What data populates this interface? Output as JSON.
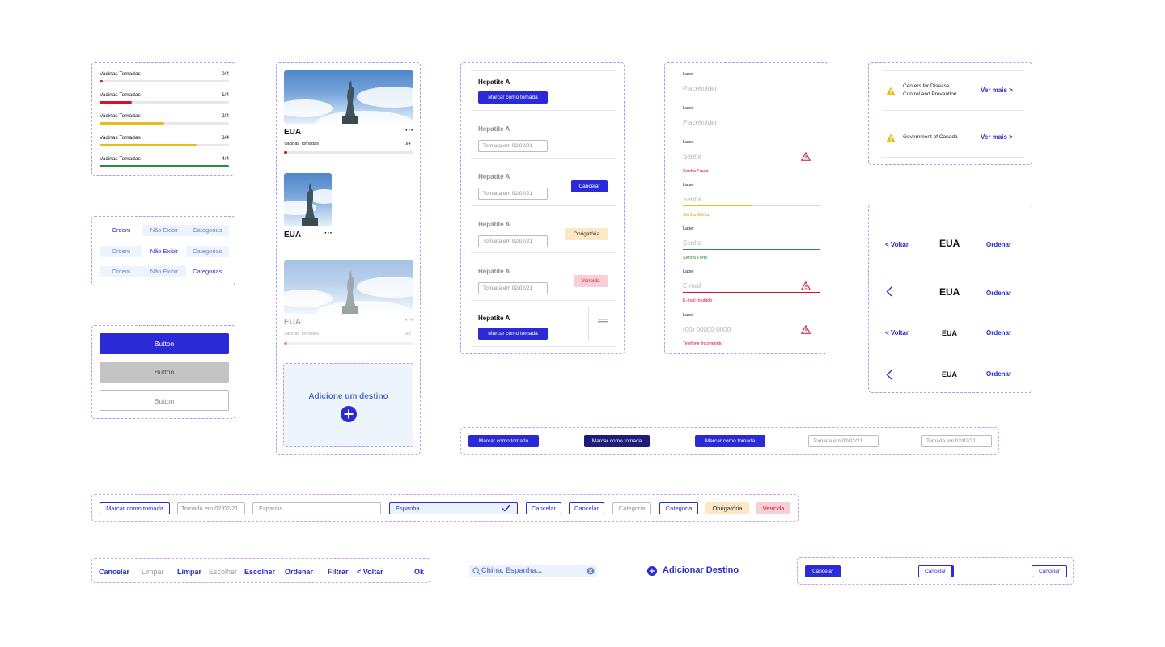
{
  "progress": {
    "rows": [
      {
        "label": "Vacinas Tomadas",
        "count": "0/4",
        "fraction": 0.0,
        "color": "#d6102c"
      },
      {
        "label": "Vacinas Tomadas",
        "count": "1/4",
        "fraction": 0.25,
        "color": "#d6102c"
      },
      {
        "label": "Vacinas Tomadas",
        "count": "2/4",
        "fraction": 0.5,
        "color": "#e8be14"
      },
      {
        "label": "Vacinas Tomadas",
        "count": "3/4",
        "fraction": 0.75,
        "color": "#e8be14"
      },
      {
        "label": "Vacinas Tomadas",
        "count": "4/4",
        "fraction": 1.0,
        "color": "#2a8f3c"
      }
    ]
  },
  "segmented": {
    "rows": [
      {
        "items": [
          "Ordem",
          "Não Exibir",
          "Categorias"
        ],
        "active": 0
      },
      {
        "items": [
          "Ordem",
          "Não Exibir",
          "Categorias"
        ],
        "active": 1
      },
      {
        "items": [
          "Ordem",
          "Não Exibir",
          "Categorias"
        ],
        "active": 2
      }
    ]
  },
  "buttons": {
    "primary": "Button",
    "disabled": "Button",
    "outline": "Button"
  },
  "cards": {
    "card1": {
      "title": "EUA",
      "progress_label": "Vacinas Tomadas",
      "progress_count": "0/4"
    },
    "card2": {
      "title": "EUA"
    },
    "card3": {
      "title": "EUA",
      "progress_label": "Vacinas Tomadas",
      "progress_count": "0/4"
    },
    "add": {
      "label": "Adicione um destino"
    }
  },
  "vaccines": {
    "rows": [
      {
        "name": "Hepatite A",
        "action": "Marcar como tomada"
      },
      {
        "name": "Hepatite A",
        "taken": "Tomada em 02/02/21"
      },
      {
        "name": "Hepatite A",
        "taken": "Tomada em 02/02/21",
        "badge": "Cancelar"
      },
      {
        "name": "Hepatite A",
        "taken": "Tomada em 02/02/21",
        "badge": "Obrigatória"
      },
      {
        "name": "Hepatite A",
        "taken": "Tomada em 02/02/21",
        "badge": "Vencida"
      },
      {
        "name": "Hepatite A",
        "action": "Marcar como tomada"
      }
    ]
  },
  "form": {
    "fields": [
      {
        "label": "Label",
        "placeholder": "Placeholder",
        "helper": ""
      },
      {
        "label": "Label",
        "placeholder": "Placeholder",
        "helper": ""
      },
      {
        "label": "Label",
        "placeholder": "Senha",
        "helper": "Senha Fraca"
      },
      {
        "label": "Label",
        "placeholder": "Senha",
        "helper": "Senha Média"
      },
      {
        "label": "Label",
        "placeholder": "Senha",
        "helper": "Senha Forte"
      },
      {
        "label": "Label",
        "placeholder": "E-mail",
        "helper": "E-mail Inválido"
      },
      {
        "label": "Label",
        "placeholder": "(00) 00000-0000",
        "helper": "Telefone Incompleto"
      }
    ]
  },
  "sources": {
    "items": [
      {
        "line1": "Centers for Disease",
        "line2": "Control and Prevention",
        "link": "Ver mais >"
      },
      {
        "line1": "Government of Canada",
        "line2": "",
        "link": "Ver mais >"
      }
    ]
  },
  "headers": {
    "rows": [
      {
        "back": "< Voltar",
        "title": "EUA",
        "action": "Ordenar"
      },
      {
        "back": "",
        "title": "EUA",
        "action": "Ordenar"
      },
      {
        "back": "< Voltar",
        "title": "EUA",
        "action": "Ordenar"
      },
      {
        "back": "",
        "title": "EUA",
        "action": "Ordenar"
      }
    ]
  },
  "mark_chips": {
    "items": [
      "Marcar como tomada",
      "Marcar como tomada",
      "Marcar como tomada",
      "Tomada em 02/02/21",
      "Tomada em 02/02/21"
    ]
  },
  "inline_chips": {
    "items": [
      "Marcar como tomada",
      "Tomada em 02/02/21",
      "Espanha",
      "Espanha",
      "Cancelar",
      "Cancelar",
      "Categoria",
      "Categoria",
      "Obrigatória",
      "Vencida"
    ]
  },
  "text_links": {
    "items": [
      "Cancelar",
      "Limpar",
      "Limpar",
      "Escolher",
      "Escolher",
      "Ordenar",
      "Filtrar",
      "< Voltar",
      "Ok"
    ]
  },
  "search": {
    "placeholder": "China, Espanha..."
  },
  "add_destination": {
    "label": "Adicionar Destino"
  },
  "cancel_buttons": {
    "items": [
      "Cancelar",
      "Cancelar",
      "Cancelar"
    ]
  },
  "colors": {
    "primary": "#2a2ad6",
    "danger": "#d6102c",
    "warning": "#e8be14",
    "success": "#2a8f3c",
    "dashed": "#a99ef2"
  }
}
